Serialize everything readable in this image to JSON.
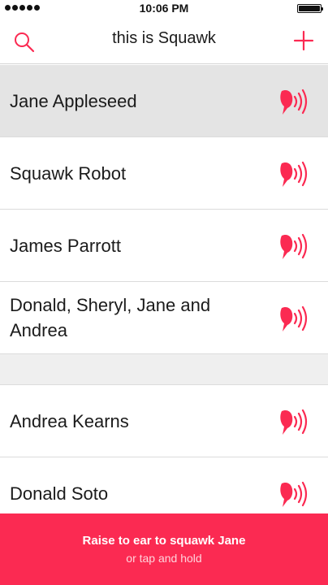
{
  "status_bar": {
    "time": "10:06 PM"
  },
  "nav": {
    "title": "this is Squawk"
  },
  "contacts": [
    {
      "name": "Jane Appleseed",
      "selected": true
    },
    {
      "name": "Squawk Robot",
      "selected": false
    },
    {
      "name": "James Parrott",
      "selected": false
    },
    {
      "name": "Donald, Sheryl, Jane and Andrea",
      "selected": false
    },
    {
      "name": "Andrea Kearns",
      "selected": false
    },
    {
      "name": "Donald Soto",
      "selected": false
    }
  ],
  "bottom_bar": {
    "primary": "Raise to ear to squawk Jane",
    "secondary": "or tap and hold"
  },
  "colors": {
    "accent": "#fb2a52",
    "selected_row": "#e4e4e4"
  },
  "icons": {
    "search": "search-icon",
    "add": "plus-icon",
    "squawk": "squawk-bird-icon"
  }
}
